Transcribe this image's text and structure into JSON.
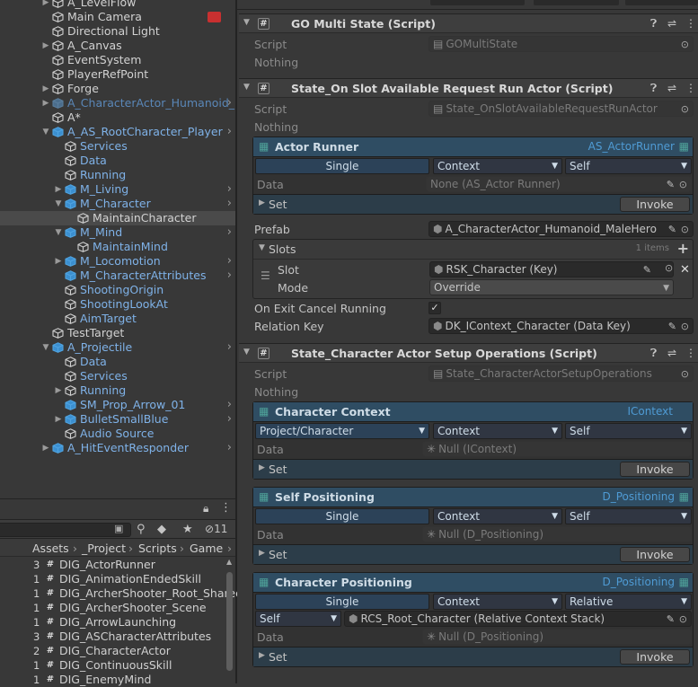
{
  "hierarchy": {
    "rows": [
      {
        "label": "A_LevelFlow",
        "indent": 0,
        "arrow": "right",
        "icon": "gameobject",
        "style": "normal",
        "chevron": false
      },
      {
        "label": "Main Camera",
        "indent": 0,
        "arrow": "",
        "icon": "gameobject",
        "style": "normal",
        "chevron": false,
        "badge": true
      },
      {
        "label": "Directional Light",
        "indent": 0,
        "arrow": "",
        "icon": "gameobject",
        "style": "normal",
        "chevron": false
      },
      {
        "label": "A_Canvas",
        "indent": 0,
        "arrow": "right",
        "icon": "gameobject",
        "style": "normal",
        "chevron": false
      },
      {
        "label": "EventSystem",
        "indent": 0,
        "arrow": "",
        "icon": "gameobject",
        "style": "normal",
        "chevron": false
      },
      {
        "label": "PlayerRefPoint",
        "indent": 0,
        "arrow": "",
        "icon": "gameobject",
        "style": "normal",
        "chevron": false
      },
      {
        "label": "Forge",
        "indent": 0,
        "arrow": "right",
        "icon": "gameobject",
        "style": "normal",
        "chevron": false
      },
      {
        "label": "A_CharacterActor_Humanoid_M",
        "indent": 0,
        "arrow": "right",
        "icon": "prefab-faded",
        "style": "gray",
        "chevron": true
      },
      {
        "label": "A*",
        "indent": 0,
        "arrow": "",
        "icon": "gameobject",
        "style": "normal",
        "chevron": false
      },
      {
        "label": "A_AS_RootCharacter_Player",
        "indent": 0,
        "arrow": "down",
        "icon": "prefab",
        "style": "blue",
        "chevron": true
      },
      {
        "label": "Services",
        "indent": 1,
        "arrow": "",
        "icon": "gameobject",
        "style": "blue",
        "chevron": false
      },
      {
        "label": "Data",
        "indent": 1,
        "arrow": "",
        "icon": "gameobject",
        "style": "blue",
        "chevron": false
      },
      {
        "label": "Running",
        "indent": 1,
        "arrow": "",
        "icon": "gameobject",
        "style": "blue",
        "chevron": false
      },
      {
        "label": "M_Living",
        "indent": 1,
        "arrow": "right",
        "icon": "prefab",
        "style": "blue",
        "chevron": true
      },
      {
        "label": "M_Character",
        "indent": 1,
        "arrow": "down",
        "icon": "prefab",
        "style": "blue",
        "chevron": true
      },
      {
        "label": "MaintainCharacter",
        "indent": 2,
        "arrow": "",
        "icon": "gameobject",
        "style": "normal",
        "chevron": false,
        "selected": true
      },
      {
        "label": "M_Mind",
        "indent": 1,
        "arrow": "down",
        "icon": "prefab",
        "style": "blue",
        "chevron": true
      },
      {
        "label": "MaintainMind",
        "indent": 2,
        "arrow": "",
        "icon": "gameobject",
        "style": "blue",
        "chevron": false
      },
      {
        "label": "M_Locomotion",
        "indent": 1,
        "arrow": "right",
        "icon": "prefab",
        "style": "blue",
        "chevron": true
      },
      {
        "label": "M_CharacterAttributes",
        "indent": 1,
        "arrow": "",
        "icon": "prefab",
        "style": "blue",
        "chevron": true
      },
      {
        "label": "ShootingOrigin",
        "indent": 1,
        "arrow": "",
        "icon": "gameobject",
        "style": "blue",
        "chevron": false
      },
      {
        "label": "ShootingLookAt",
        "indent": 1,
        "arrow": "",
        "icon": "gameobject",
        "style": "blue",
        "chevron": false
      },
      {
        "label": "AimTarget",
        "indent": 1,
        "arrow": "",
        "icon": "gameobject",
        "style": "blue",
        "chevron": false
      },
      {
        "label": "TestTarget",
        "indent": 0,
        "arrow": "",
        "icon": "gameobject",
        "style": "normal",
        "chevron": false
      },
      {
        "label": "A_Projectile",
        "indent": 0,
        "arrow": "down",
        "icon": "prefab",
        "style": "blue",
        "chevron": true
      },
      {
        "label": "Data",
        "indent": 1,
        "arrow": "",
        "icon": "gameobject",
        "style": "blue",
        "chevron": false
      },
      {
        "label": "Services",
        "indent": 1,
        "arrow": "",
        "icon": "gameobject",
        "style": "blue",
        "chevron": false
      },
      {
        "label": "Running",
        "indent": 1,
        "arrow": "right",
        "icon": "gameobject",
        "style": "blue",
        "chevron": false
      },
      {
        "label": "SM_Prop_Arrow_01",
        "indent": 1,
        "arrow": "",
        "icon": "prefab",
        "style": "blue",
        "chevron": true
      },
      {
        "label": "BulletSmallBlue",
        "indent": 1,
        "arrow": "right",
        "icon": "prefab",
        "style": "blue",
        "chevron": true
      },
      {
        "label": "Audio Source",
        "indent": 1,
        "arrow": "",
        "icon": "gameobject",
        "style": "blue",
        "chevron": false
      },
      {
        "label": "A_HitEventResponder",
        "indent": 0,
        "arrow": "right",
        "icon": "prefab",
        "style": "blue",
        "chevron": true
      }
    ]
  },
  "project": {
    "hidden_count": "11",
    "breadcrumb": [
      "Assets",
      "_Project",
      "Scripts",
      "Game"
    ],
    "files": [
      {
        "count": "3",
        "name": "DIG_ActorRunner"
      },
      {
        "count": "1",
        "name": "DIG_AnimationEndedSkill"
      },
      {
        "count": "1",
        "name": "DIG_ArcherShooter_Root_Shared"
      },
      {
        "count": "1",
        "name": "DIG_ArcherShooter_Scene"
      },
      {
        "count": "1",
        "name": "DIG_ArrowLaunching"
      },
      {
        "count": "3",
        "name": "DIG_ASCharacterAttributes"
      },
      {
        "count": "2",
        "name": "DIG_CharacterActor"
      },
      {
        "count": "1",
        "name": "DIG_ContinuousSkill"
      },
      {
        "count": "1",
        "name": "DIG_EnemyMind"
      }
    ]
  },
  "inspector": {
    "script_label": "Script",
    "nothing_label": "Nothing",
    "comp1": {
      "title": "GO Multi State (Script)",
      "script": "GOMultiState"
    },
    "comp2": {
      "title": "State_On Slot Available Request Run Actor (Script)",
      "script": "State_OnSlotAvailableRequestRunActor",
      "binding": {
        "name": "Actor Runner",
        "type": "AS_ActorRunner",
        "dd1": "Single",
        "dd2": "Context",
        "dd3": "Self",
        "data_label": "Data",
        "data_value": "None (AS_Actor Runner)",
        "set_label": "Set",
        "invoke_label": "Invoke"
      },
      "prefab_label": "Prefab",
      "prefab_value": "A_CharacterActor_Humanoid_MaleHero",
      "slots_label": "Slots",
      "slots_count": "1 items",
      "slot_label": "Slot",
      "slot_value": "RSK_Character (Key)",
      "mode_label": "Mode",
      "mode_value": "Override",
      "on_exit_label": "On Exit Cancel Running",
      "on_exit_checked": "✓",
      "relation_key_label": "Relation Key",
      "relation_key_value": "DK_IContext_Character (Data Key)"
    },
    "comp3": {
      "title": "State_Character Actor Setup Operations (Script)",
      "script": "State_CharacterActorSetupOperations",
      "bindings": [
        {
          "name": "Character Context",
          "type": "IContext",
          "dd1": "Project/Character",
          "dd2": "Context",
          "dd3": "Self",
          "data_label": "Data",
          "data_value": "Null (IContext)",
          "set_label": "Set",
          "invoke_label": "Invoke"
        },
        {
          "name": "Self Positioning",
          "type": "D_Positioning",
          "dd1": "Single",
          "dd2": "Context",
          "dd3": "Self",
          "data_label": "Data",
          "data_value": "Null (D_Positioning)",
          "set_label": "Set",
          "invoke_label": "Invoke"
        },
        {
          "name": "Character Positioning",
          "type": "D_Positioning",
          "dd1": "Single",
          "dd2": "Context",
          "dd3": "Relative",
          "dd4": "Self",
          "stack_value": "RCS_Root_Character (Relative Context Stack)",
          "data_label": "Data",
          "data_value": "Null (D_Positioning)",
          "set_label": "Set",
          "invoke_label": "Invoke"
        }
      ]
    }
  }
}
